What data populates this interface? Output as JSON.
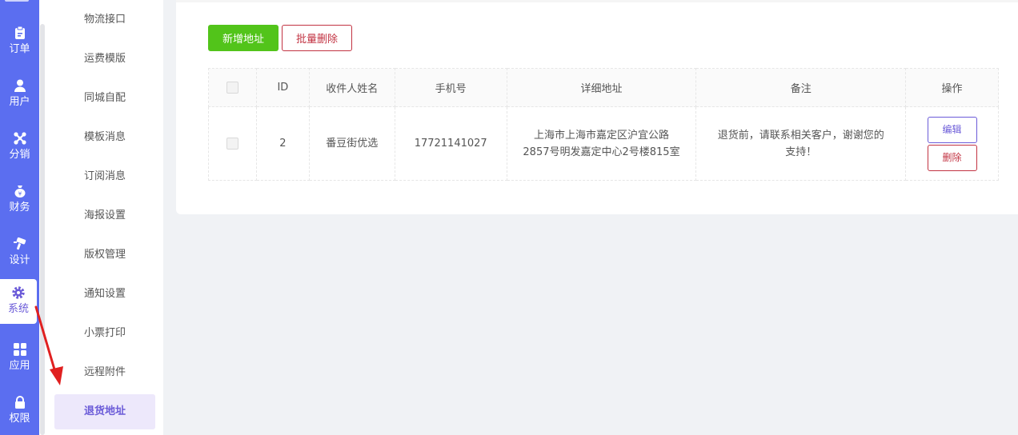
{
  "rail": {
    "items": [
      {
        "label": "订单",
        "icon": "clipboard-icon"
      },
      {
        "label": "用户",
        "icon": "user-icon"
      },
      {
        "label": "分销",
        "icon": "share-network-icon"
      },
      {
        "label": "财务",
        "icon": "money-bag-icon"
      },
      {
        "label": "设计",
        "icon": "brush-icon"
      },
      {
        "label": "系统",
        "icon": "gear-icon",
        "active": true
      },
      {
        "label": "应用",
        "icon": "apps-grid-icon"
      },
      {
        "label": "权限",
        "icon": "lock-icon"
      }
    ],
    "bg_color": "#5b6ef0"
  },
  "submenu": {
    "items": [
      "物流接口",
      "运费模版",
      "同城自配",
      "模板消息",
      "订阅消息",
      "海报设置",
      "版权管理",
      "通知设置",
      "小票打印",
      "远程附件",
      "退货地址"
    ],
    "active": "退货地址"
  },
  "toolbar": {
    "add_label": "新增地址",
    "batch_delete_label": "批量删除"
  },
  "table": {
    "headers": [
      "ID",
      "收件人姓名",
      "手机号",
      "详细地址",
      "备注",
      "操作"
    ],
    "rows": [
      {
        "id": "2",
        "name": "番豆街优选",
        "phone": "17721141027",
        "address_line1": "上海市上海市嘉定区沪宜公路",
        "address_line2": "2857号明发嘉定中心2号楼815室",
        "remark_line1": "退货前，请联系相关客户，谢谢您的",
        "remark_line2": "支持！",
        "edit_label": "编辑",
        "delete_label": "删除"
      }
    ]
  },
  "colors": {
    "accent": "#6b5bd8",
    "add_button": "#52c41a",
    "danger": "#c23342",
    "annotation_arrow": "#e02020"
  }
}
